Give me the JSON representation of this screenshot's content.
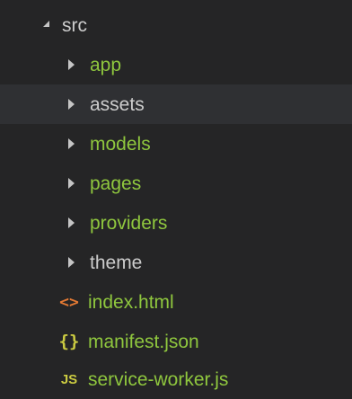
{
  "root": {
    "label": "src"
  },
  "folders": [
    {
      "label": "app"
    },
    {
      "label": "assets"
    },
    {
      "label": "models"
    },
    {
      "label": "pages"
    },
    {
      "label": "providers"
    },
    {
      "label": "theme"
    }
  ],
  "files": [
    {
      "label": "index.html",
      "icon": "html-icon",
      "glyph": "<>"
    },
    {
      "label": "manifest.json",
      "icon": "json-icon",
      "glyph": "{}"
    },
    {
      "label": "service-worker.js",
      "icon": "js-icon",
      "glyph": "JS"
    }
  ],
  "colors": {
    "background": "#252526",
    "selected_row": "#2f3033",
    "folder_text": "#8fc73e",
    "file_text": "#cccccc",
    "html_icon": "#e37933",
    "json_icon": "#cbcb41",
    "js_icon": "#cbcb41"
  }
}
